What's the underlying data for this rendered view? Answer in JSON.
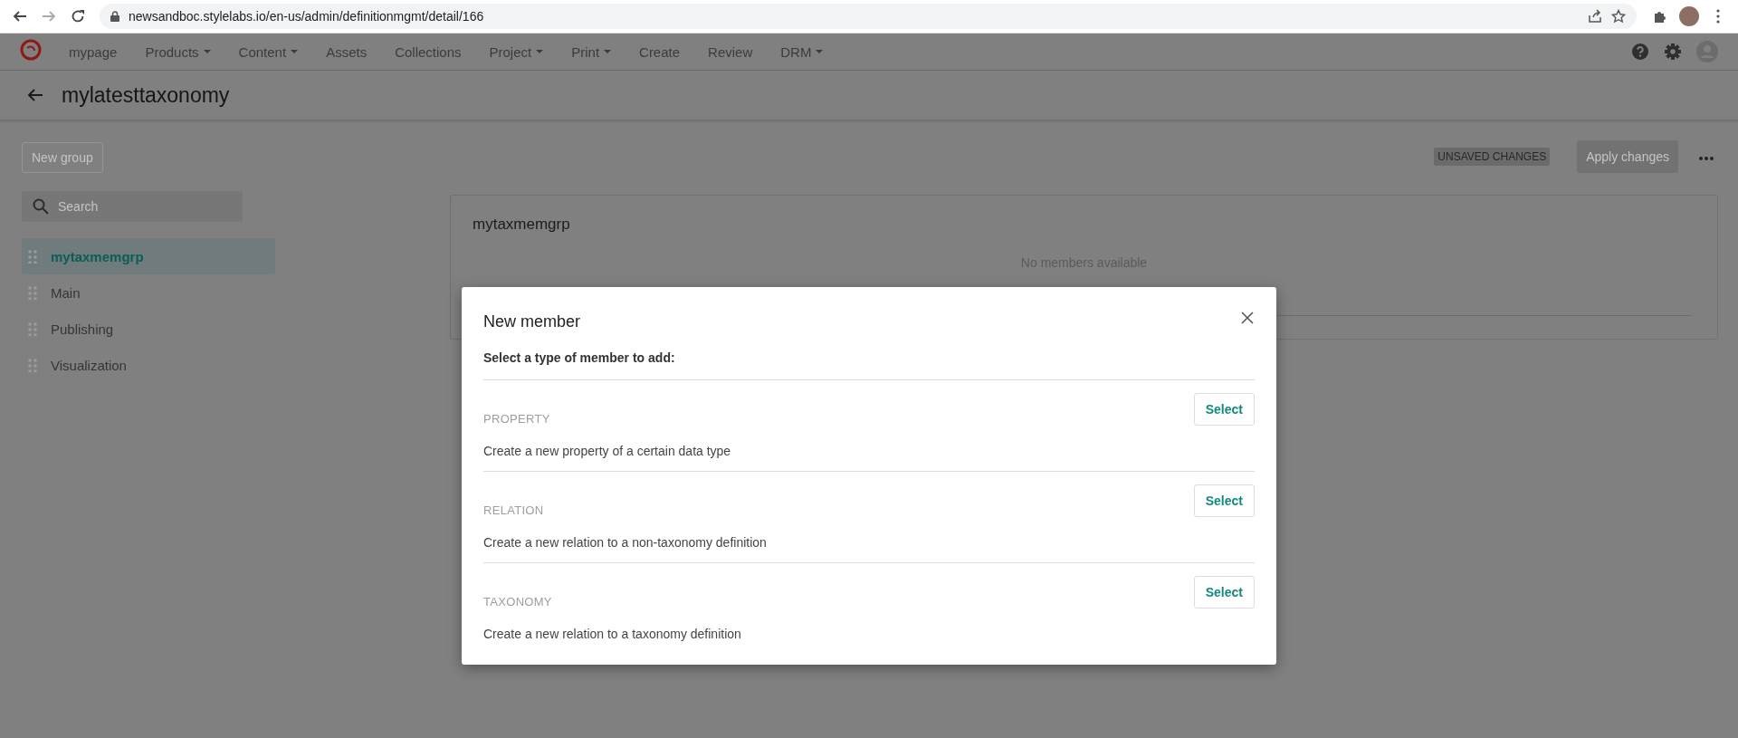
{
  "browser": {
    "url": "newsandboc.stylelabs.io/en-us/admin/definitionmgmt/detail/166"
  },
  "nav": {
    "items": [
      {
        "label": "mypage",
        "dropdown": false
      },
      {
        "label": "Products",
        "dropdown": true
      },
      {
        "label": "Content",
        "dropdown": true
      },
      {
        "label": "Assets",
        "dropdown": false
      },
      {
        "label": "Collections",
        "dropdown": false
      },
      {
        "label": "Project",
        "dropdown": true
      },
      {
        "label": "Print",
        "dropdown": true
      },
      {
        "label": "Create",
        "dropdown": false
      },
      {
        "label": "Review",
        "dropdown": false
      },
      {
        "label": "DRM",
        "dropdown": true
      }
    ]
  },
  "page": {
    "title": "mylatesttaxonomy"
  },
  "toolbar": {
    "new_group": "New group",
    "status_badge": "UNSAVED CHANGES",
    "apply_button": "Apply changes"
  },
  "sidebar": {
    "search": {
      "placeholder": "Search"
    },
    "items": [
      {
        "label": "mytaxmemgrp",
        "selected": true
      },
      {
        "label": "Main",
        "selected": false
      },
      {
        "label": "Publishing",
        "selected": false
      },
      {
        "label": "Visualization",
        "selected": false
      }
    ]
  },
  "group_card": {
    "title": "mytaxmemgrp",
    "empty_text": "No members available"
  },
  "dialog": {
    "title": "New member",
    "subtitle": "Select a type of member to add:",
    "options": [
      {
        "type": "PROPERTY",
        "description": "Create a new property of a certain data type",
        "button": "Select"
      },
      {
        "type": "RELATION",
        "description": "Create a new relation to a non-taxonomy definition",
        "button": "Select"
      },
      {
        "type": "TAXONOMY",
        "description": "Create a new relation to a taxonomy definition",
        "button": "Select"
      }
    ]
  }
}
